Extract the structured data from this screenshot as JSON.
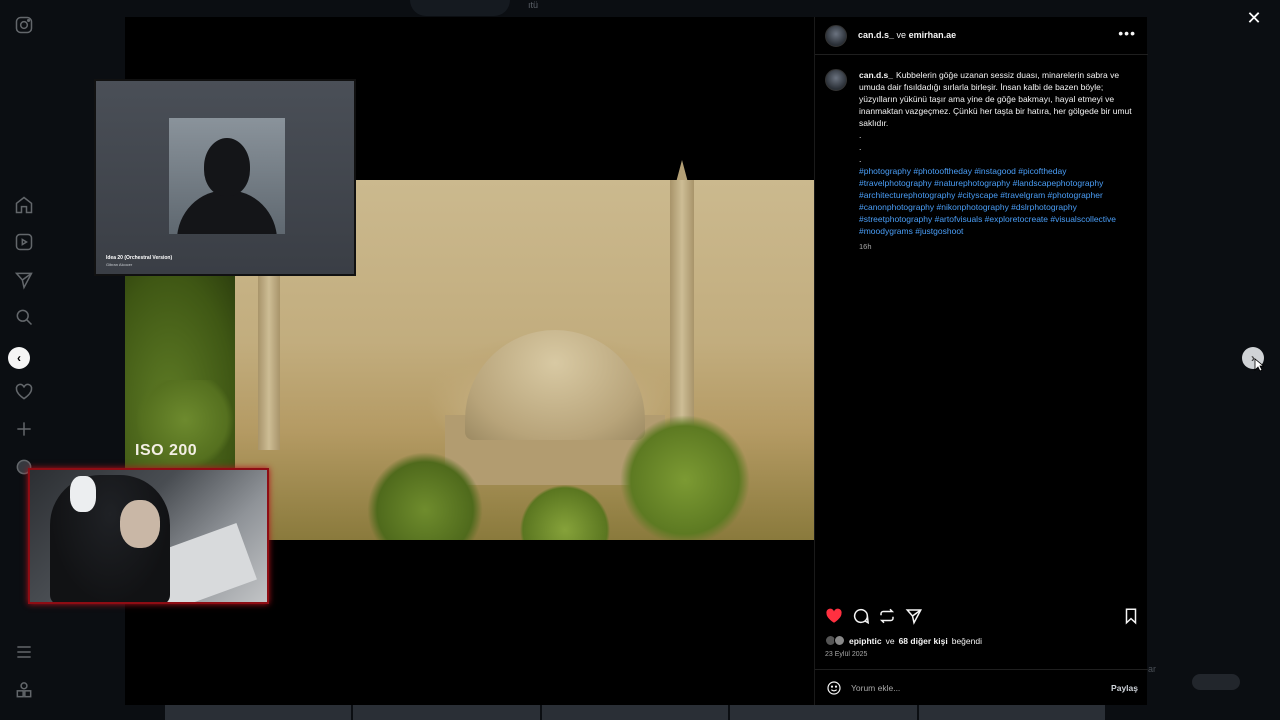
{
  "post": {
    "header_user1": "can.d.s_",
    "header_joiner": "ve",
    "header_user2": "emirhan.ae",
    "more": "•••",
    "caption_user": "can.d.s_",
    "caption_text": "Kubbelerin göğe uzanan sessiz duası, minarelerin sabra ve umuda dair fısıldadığı sırlarla birleşir. İnsan kalbi de bazen böyle; yüzyılların yükünü taşır ama yine de göğe bakmayı, hayal etmeyi ve inanmaktan vazgeçmez. Çünkü her taşta bir hatıra, her gölgede bir umut saklıdır.",
    "dots": [
      ".",
      ".",
      "."
    ],
    "hashtags": "#photography #photooftheday #instagood #picoftheday #travelphotography #naturephotography #landscapephotography #architecturephotography #cityscape #travelgram #photographer #canonphotography #nikonphotography #dslrphotography #streetphotography #artofvisuals #exploretocreate #visualscollective #moodygrams #justgoshoot",
    "time_ago": "16h",
    "likes_user": "epiphtic",
    "likes_joiner": "ve",
    "likes_count_text": "68 diğer kişi",
    "likes_suffix": "beğendi",
    "date": "23 Eylül 2025",
    "comment_placeholder": "Yorum ekle...",
    "share_label": "Paylaş"
  },
  "media": {
    "overlay_text": "ISO 200"
  },
  "music_overlay": {
    "title": "Idea 20 (Orchestral Version)",
    "artist": "Gibran Alcocer"
  },
  "controls": {
    "close": "✕",
    "prev": "‹",
    "next": "›"
  },
  "background": {
    "right_text": "ar",
    "top_text": "ıtü"
  },
  "colors": {
    "accent_link": "#4a9ef7",
    "like_red": "#ff3040",
    "panel_bg": "#000000"
  },
  "icons": {
    "rail": [
      "instagram-icon",
      "home-icon",
      "reels-icon",
      "send-icon",
      "search-icon",
      "heart-icon",
      "plus-icon",
      "profile-icon",
      "menu-icon",
      "apps-icon"
    ],
    "actions": [
      "heart-icon",
      "comment-icon",
      "repost-icon",
      "share-icon",
      "bookmark-icon"
    ]
  }
}
